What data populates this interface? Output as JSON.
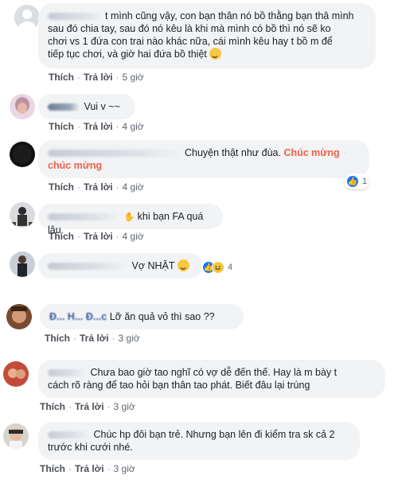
{
  "actions": {
    "like": "Thích",
    "reply": "Trả lời"
  },
  "comments": [
    {
      "text_l1": "t mình cũng vậy, con bạn thân nó bồ thằng bạn thâ mình",
      "text_l2": "sau đó chia tay, sau đó nó kêu là khi mà mình có bồ thì nó sẽ ko",
      "text_l3": "chơi vs 1 đứa con trai nào khác nữa, cái mình kêu hay t bồ m để",
      "text_l4": "tiếp tục chơi, và giờ hai đứa bồ thiệt",
      "time": "5 giờ"
    },
    {
      "text": "Vui v ~~",
      "time": "4 giờ"
    },
    {
      "text": "Chuyện thật như đùa.",
      "highlight_l1": "Chúc mừng",
      "highlight_l2": "chúc mừng",
      "time": "4 giờ",
      "reactions": "1"
    },
    {
      "text": "khi bạn FA quá lâu",
      "time": "4 giờ"
    },
    {
      "text": "Vợ NHẶT",
      "time": "",
      "reactions": "4"
    },
    {
      "name": "Đ... H... Đ...c",
      "text": "Lỡ ăn quả vỏ thì sao ??",
      "time": "3 giờ"
    },
    {
      "text_l1": "Chưa bao giờ tao nghĩ có vợ dễ đến thế. Hay là m bày t",
      "text_l2": "cách rõ ràng để tao hỏi bạn thân tao phát. Biết đâu lại trúng",
      "time": "3 giờ"
    },
    {
      "text_l1": "Chúc hp đôi bạn trẻ. Nhưng bạn lên đi kiểm tra sk cả 2",
      "text_l2": "trước khi cưới nhé.",
      "time": "3 giờ"
    }
  ],
  "colors": {
    "bubble": "#f2f3f5",
    "link": "#4b4f56",
    "highlight": "#f0614a",
    "like_blue": "#1877f2"
  }
}
